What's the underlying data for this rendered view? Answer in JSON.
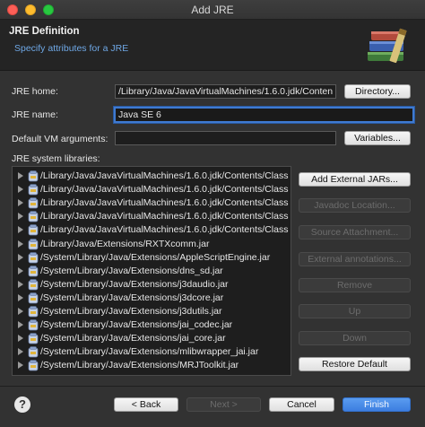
{
  "window": {
    "title": "Add JRE"
  },
  "banner": {
    "title": "JRE Definition",
    "subtitle": "Specify attributes for a JRE",
    "icon": "books-icon"
  },
  "form": {
    "jre_home_label": "JRE home:",
    "jre_home_value": "/Library/Java/JavaVirtualMachines/1.6.0.jdk/Conten",
    "directory_button": "Directory...",
    "jre_name_label": "JRE name:",
    "jre_name_value": "Java SE 6",
    "vm_args_label": "Default VM arguments:",
    "vm_args_value": "",
    "variables_button": "Variables...",
    "libraries_label": "JRE system libraries:"
  },
  "libraries": [
    "/Library/Java/JavaVirtualMachines/1.6.0.jdk/Contents/Class",
    "/Library/Java/JavaVirtualMachines/1.6.0.jdk/Contents/Class",
    "/Library/Java/JavaVirtualMachines/1.6.0.jdk/Contents/Class",
    "/Library/Java/JavaVirtualMachines/1.6.0.jdk/Contents/Class",
    "/Library/Java/JavaVirtualMachines/1.6.0.jdk/Contents/Class",
    "/Library/Java/Extensions/RXTXcomm.jar",
    "/System/Library/Java/Extensions/AppleScriptEngine.jar",
    "/System/Library/Java/Extensions/dns_sd.jar",
    "/System/Library/Java/Extensions/j3daudio.jar",
    "/System/Library/Java/Extensions/j3dcore.jar",
    "/System/Library/Java/Extensions/j3dutils.jar",
    "/System/Library/Java/Extensions/jai_codec.jar",
    "/System/Library/Java/Extensions/jai_core.jar",
    "/System/Library/Java/Extensions/mlibwrapper_jai.jar",
    "/System/Library/Java/Extensions/MRJToolkit.jar"
  ],
  "side_buttons": {
    "add_external_jars": "Add External JARs...",
    "javadoc_location": "Javadoc Location...",
    "source_attachment": "Source Attachment...",
    "external_annotations": "External annotations...",
    "remove": "Remove",
    "up": "Up",
    "down": "Down",
    "restore_default": "Restore Default"
  },
  "footer": {
    "help": "?",
    "back": "< Back",
    "next": "Next >",
    "cancel": "Cancel",
    "finish": "Finish"
  }
}
